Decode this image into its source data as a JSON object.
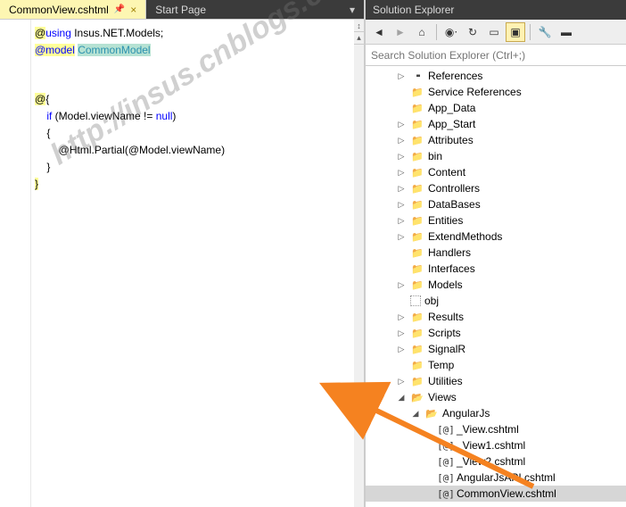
{
  "tabs": {
    "active": "CommonView.cshtml",
    "other": "Start Page"
  },
  "code": {
    "l1a": "@",
    "l1b": "using",
    "l1c": " Insus.NET.Models;",
    "l2a": "@model",
    "l2b": " ",
    "l2c": "CommonModel",
    "l4": "@",
    "l4b": "{",
    "l5a": "    ",
    "l5b": "if",
    "l5c": " (Model.viewName != ",
    "l5d": "null",
    "l5e": ")",
    "l6": "    {",
    "l7": "        @Html.Partial(@Model.viewName)",
    "l8": "    }",
    "l9": "}"
  },
  "sx": {
    "title": "Solution Explorer",
    "search_ph": "Search Solution Explorer (Ctrl+;)",
    "nodes": [
      {
        "d": 1,
        "exp": "▷",
        "ico": "ref",
        "label": "References"
      },
      {
        "d": 1,
        "exp": " ",
        "ico": "folder",
        "label": "Service References"
      },
      {
        "d": 1,
        "exp": " ",
        "ico": "folder",
        "label": "App_Data"
      },
      {
        "d": 1,
        "exp": "▷",
        "ico": "folder",
        "label": "App_Start"
      },
      {
        "d": 1,
        "exp": "▷",
        "ico": "folder",
        "label": "Attributes"
      },
      {
        "d": 1,
        "exp": "▷",
        "ico": "folder",
        "label": "bin"
      },
      {
        "d": 1,
        "exp": "▷",
        "ico": "folder",
        "label": "Content"
      },
      {
        "d": 1,
        "exp": "▷",
        "ico": "folder",
        "label": "Controllers"
      },
      {
        "d": 1,
        "exp": "▷",
        "ico": "folder",
        "label": "DataBases"
      },
      {
        "d": 1,
        "exp": "▷",
        "ico": "folder",
        "label": "Entities"
      },
      {
        "d": 1,
        "exp": "▷",
        "ico": "folder",
        "label": "ExtendMethods"
      },
      {
        "d": 1,
        "exp": " ",
        "ico": "folder",
        "label": "Handlers"
      },
      {
        "d": 1,
        "exp": " ",
        "ico": "folder",
        "label": "Interfaces"
      },
      {
        "d": 1,
        "exp": "▷",
        "ico": "folder",
        "label": "Models"
      },
      {
        "d": 1,
        "exp": " ",
        "ico": "obj",
        "label": "obj"
      },
      {
        "d": 1,
        "exp": "▷",
        "ico": "folder",
        "label": "Results"
      },
      {
        "d": 1,
        "exp": "▷",
        "ico": "folder",
        "label": "Scripts"
      },
      {
        "d": 1,
        "exp": "▷",
        "ico": "folder",
        "label": "SignalR"
      },
      {
        "d": 1,
        "exp": " ",
        "ico": "folder",
        "label": "Temp"
      },
      {
        "d": 1,
        "exp": "▷",
        "ico": "folder",
        "label": "Utilities"
      },
      {
        "d": 1,
        "exp": "◢",
        "ico": "folder-open",
        "label": "Views"
      },
      {
        "d": 2,
        "exp": "◢",
        "ico": "folder-open",
        "label": "AngularJs"
      },
      {
        "d": 3,
        "exp": " ",
        "ico": "cshtml",
        "label": "_View.cshtml"
      },
      {
        "d": 3,
        "exp": " ",
        "ico": "cshtml",
        "label": "_View1.cshtml"
      },
      {
        "d": 3,
        "exp": " ",
        "ico": "cshtml",
        "label": "_View2.cshtml"
      },
      {
        "d": 3,
        "exp": " ",
        "ico": "cshtml",
        "label": "AngularJsAPI.cshtml"
      },
      {
        "d": 3,
        "exp": " ",
        "ico": "cshtml",
        "label": "CommonView.cshtml",
        "sel": true
      }
    ]
  },
  "watermark": "http://insus.cnblogs.com"
}
